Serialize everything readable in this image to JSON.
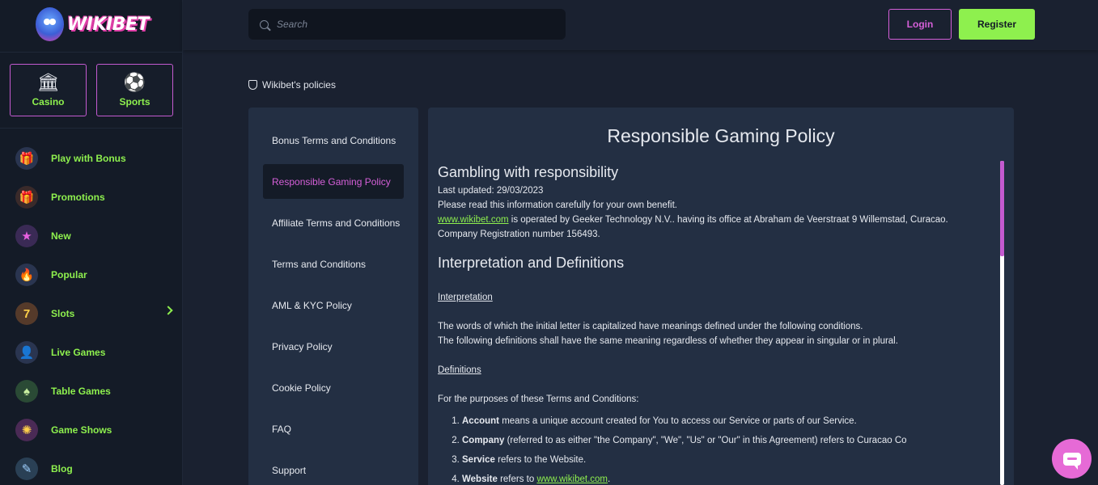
{
  "brand": {
    "logo_text": "WIKIBET"
  },
  "sidebar": {
    "categories": [
      {
        "label": "Casino",
        "icon": "casino-building-icon",
        "glyph": "🏛"
      },
      {
        "label": "Sports",
        "icon": "soccer-ball-icon",
        "glyph": "⚽"
      }
    ],
    "items": [
      {
        "label": "Play with Bonus",
        "icon": "bonus-icon",
        "glyph": "🎁",
        "bg": "#2a3550"
      },
      {
        "label": "Promotions",
        "icon": "gift-icon",
        "glyph": "🎁",
        "bg": "#3a2a2a"
      },
      {
        "label": "New",
        "icon": "star-icon",
        "glyph": "★",
        "bg": "#3a2a55"
      },
      {
        "label": "Popular",
        "icon": "fire-icon",
        "glyph": "🔥",
        "bg": "#2a3550"
      },
      {
        "label": "Slots",
        "icon": "slot-machine-icon",
        "glyph": "7",
        "bg": "#553a2a"
      },
      {
        "label": "Live Games",
        "icon": "dealer-icon",
        "glyph": "👤",
        "bg": "#2a3550"
      },
      {
        "label": "Table Games",
        "icon": "table-icon",
        "glyph": "♠",
        "bg": "#2a4a35"
      },
      {
        "label": "Game Shows",
        "icon": "wheel-icon",
        "glyph": "✺",
        "bg": "#4a2a55"
      },
      {
        "label": "Blog",
        "icon": "blog-icon",
        "glyph": "✎",
        "bg": "#2a4055"
      }
    ]
  },
  "header": {
    "search_placeholder": "Search",
    "login_label": "Login",
    "register_label": "Register"
  },
  "policies": {
    "heading": "Wikibet's policies",
    "menu": [
      "Bonus Terms and Conditions",
      "Responsible Gaming Policy",
      "Affiliate Terms and Conditions",
      "Terms and Conditions",
      "AML & KYC Policy",
      "Privacy Policy",
      "Cookie Policy",
      "FAQ",
      "Support"
    ],
    "active_index": 1
  },
  "content": {
    "title": "Responsible Gaming Policy",
    "section1_title": "Gambling with responsibility",
    "last_updated": "Last updated: 29/03/2023",
    "read_note": "Please read this information carefully for your own benefit.",
    "site_link": "www.wikibet.com",
    "operated_text": " is operated by Geeker Technology N.V.. having its office at Abraham de Veerstraat 9 Willemstad, Curacao. Company Registration number 156493.",
    "section2_title": "Interpretation and Definitions",
    "interpretation_heading": "Interpretation ",
    "interp_line1": "The words of which the initial letter is capitalized have meanings defined under the following conditions.",
    "interp_line2": "The following definitions shall have the same meaning regardless of whether they appear in singular or in plural.",
    "definitions_heading": "Definitions ",
    "purposes": "For the purposes of these Terms and Conditions:",
    "defs": [
      {
        "term": "Account",
        "text": " means a unique account created for You to access our Service or parts of our Service."
      },
      {
        "term": "Company",
        "text": " (referred to as either \"the Company\", \"We\", \"Us\" or \"Our\" in this Agreement) refers to Curacao Co"
      },
      {
        "term": "Service",
        "text": " refers to the Website."
      },
      {
        "term": "Website",
        "text": " refers to ",
        "link": "www.wikibet.com",
        "suffix": "."
      }
    ]
  },
  "colors": {
    "accent_green": "#8ef04e",
    "accent_pink": "#d55fd8",
    "panel": "#232f43"
  },
  "chat": {
    "icon": "chat-icon"
  }
}
